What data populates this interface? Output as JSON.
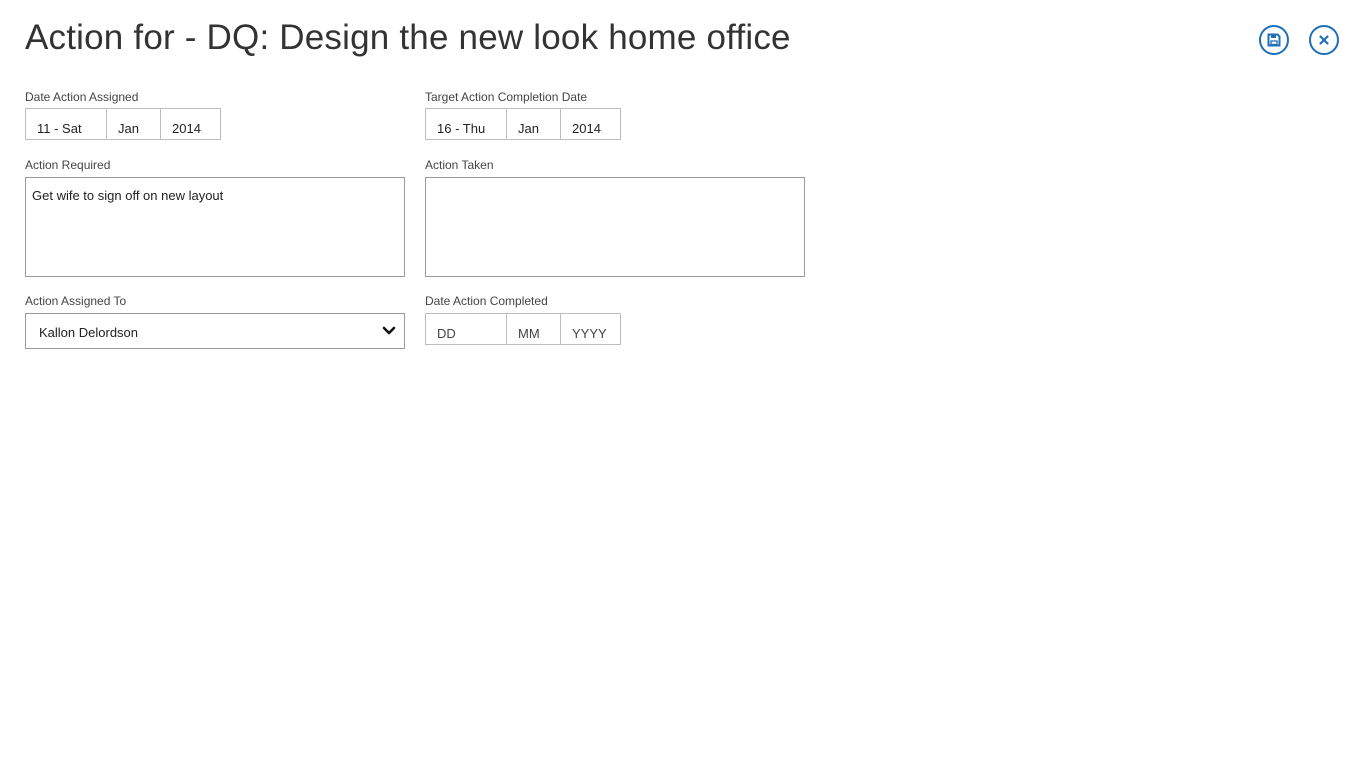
{
  "header": {
    "title": "Action for - DQ: Design the new look home office",
    "save_icon": "save-icon",
    "close_icon": "close-icon",
    "accent_color": "#1e6fb8"
  },
  "date_assigned": {
    "label": "Date Action Assigned",
    "day": "11 - Sat",
    "month": "Jan",
    "year": "2014"
  },
  "target_date": {
    "label": "Target Action Completion Date",
    "day": "16 - Thu",
    "month": "Jan",
    "year": "2014"
  },
  "action_required": {
    "label": "Action Required",
    "value": "Get wife to sign off on new layout"
  },
  "action_taken": {
    "label": "Action Taken",
    "value": ""
  },
  "assigned_to": {
    "label": "Action Assigned To",
    "value": "Kallon Delordson",
    "icon": "chevron-down-icon"
  },
  "date_completed": {
    "label": "Date Action Completed",
    "day_placeholder": "DD",
    "month_placeholder": "MM",
    "year_placeholder": "YYYY"
  }
}
